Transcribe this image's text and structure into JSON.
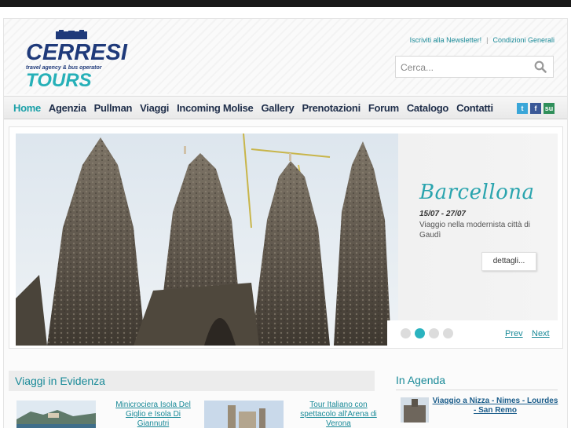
{
  "header": {
    "logo_text": "CERRESI TOURS",
    "logo_tagline": "travel agency & bus operator",
    "links": [
      "Iscriviti alla Newsletter!",
      "Condizioni Generali"
    ],
    "link_separator": "|",
    "search_placeholder": "Cerca..."
  },
  "nav": {
    "items": [
      "Home",
      "Agenzia",
      "Pullman",
      "Viaggi",
      "Incoming Molise",
      "Gallery",
      "Prenotazioni",
      "Forum",
      "Catalogo",
      "Contatti"
    ],
    "active_index": 0,
    "social_icons": [
      "twitter-icon",
      "facebook-icon",
      "stumbleupon-icon"
    ]
  },
  "slider": {
    "title": "Barcellona",
    "dates": "15/07 - 27/07",
    "description": "Viaggio nella modernista città di Gaudì",
    "button": "dettagli...",
    "dot_count": 4,
    "active_dot": 1,
    "prev": "Prev",
    "next": "Next"
  },
  "evidenza": {
    "heading": "Viaggi in Evidenza",
    "cards": [
      {
        "title": "Minicrociera Isola Del Giglio e Isola Di Giannutri"
      },
      {
        "title": "Tour Italiano con spettacolo all'Arena di Verona"
      }
    ]
  },
  "agenda": {
    "heading": "In Agenda",
    "items": [
      {
        "title": "Viaggio a Nizza - Nimes - Lourdes - San Remo"
      }
    ]
  },
  "colors": {
    "accent": "#1aa0a8",
    "nav_text": "#1f2e4a",
    "link": "#1a8a98"
  }
}
